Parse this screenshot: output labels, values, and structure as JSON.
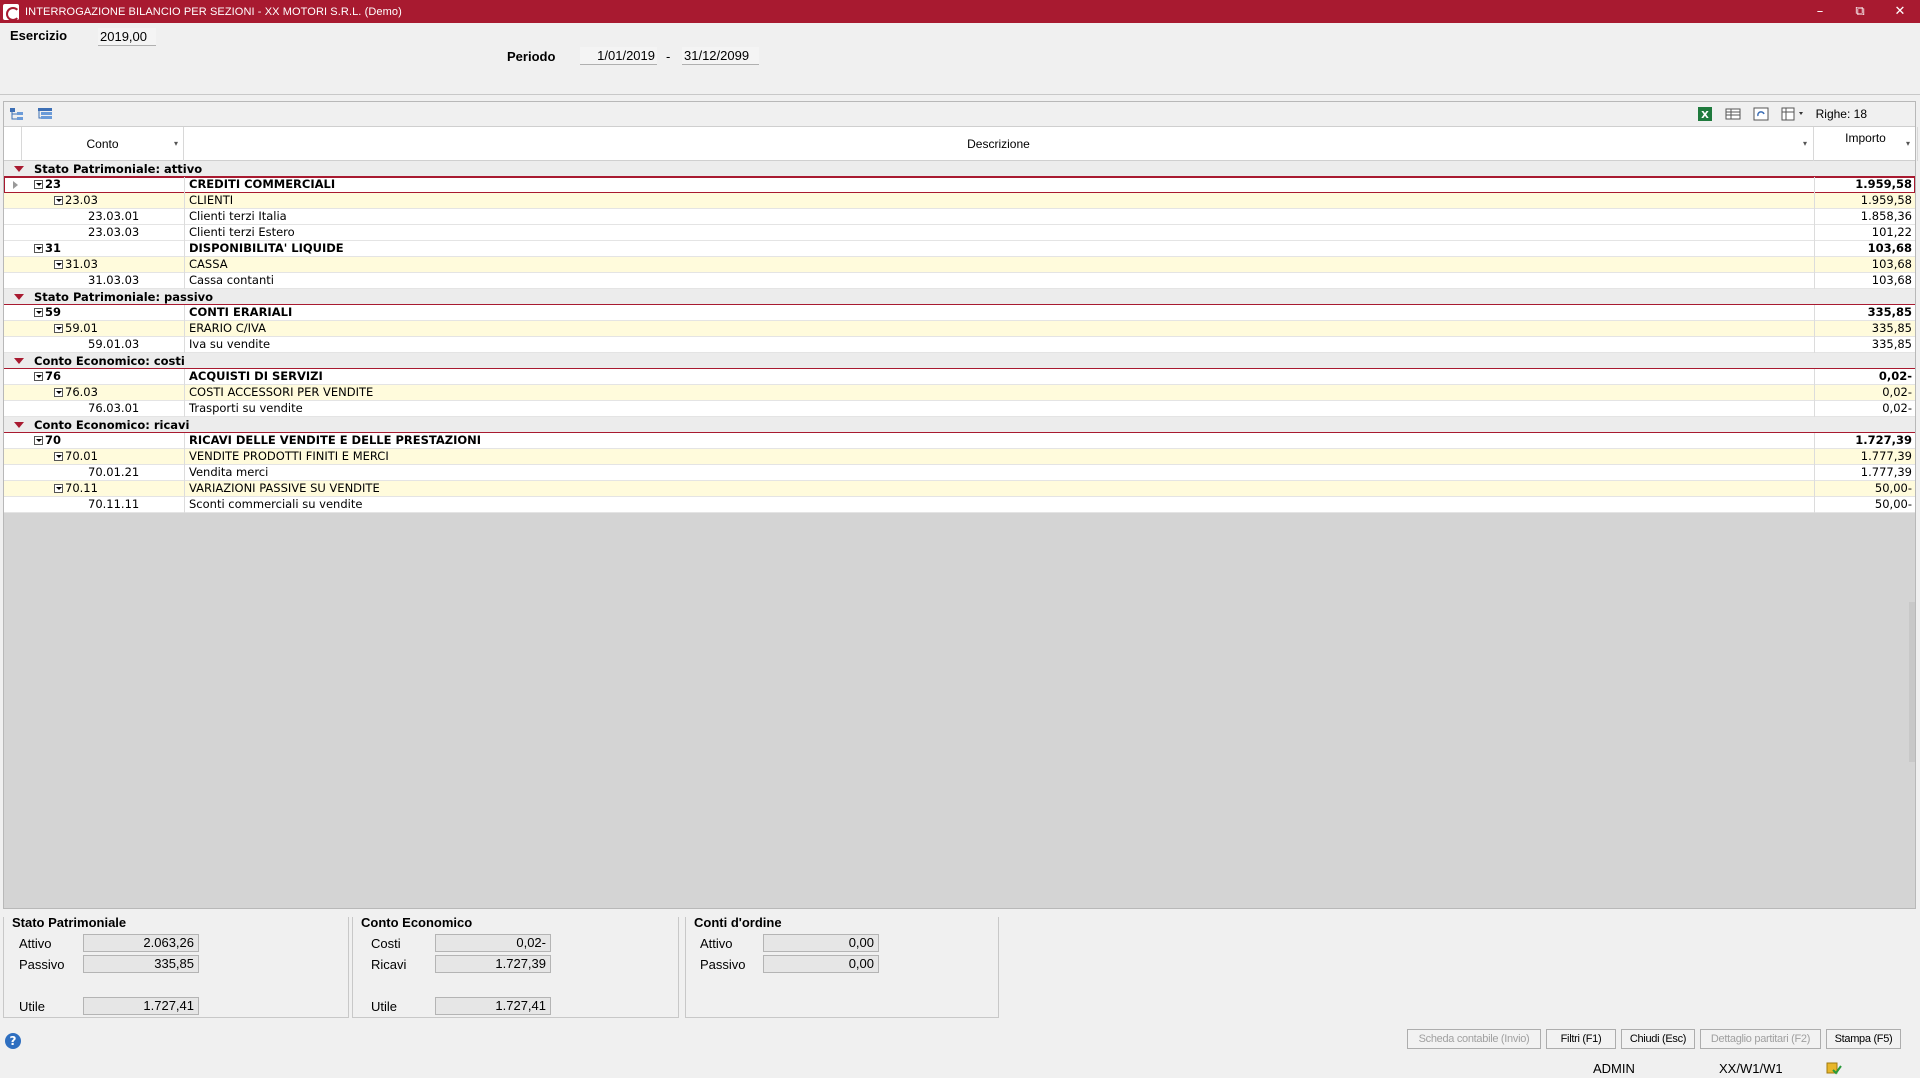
{
  "window": {
    "title": "INTERROGAZIONE BILANCIO PER SEZIONI - XX  MOTORI S.R.L.  (Demo)",
    "controls": [
      "–",
      "⧉",
      "✕"
    ]
  },
  "header": {
    "esercizio_label": "Esercizio",
    "esercizio_value": "2019,00",
    "periodo_label": "Periodo",
    "periodo_from": "1/01/2019",
    "periodo_sep": "-",
    "periodo_to": "31/12/2099"
  },
  "grid": {
    "righe_label": "Righe: 18",
    "columns": {
      "conto": "Conto",
      "descrizione": "Descrizione",
      "importo": "Importo"
    },
    "groups": [
      {
        "title": "Stato Patrimoniale: attivo",
        "rows": [
          {
            "level": 1,
            "conto": "23",
            "descrizione": "CREDITI COMMERCIALI",
            "importo": "1.959,58"
          },
          {
            "level": 2,
            "conto": "23.03",
            "descrizione": "CLIENTI",
            "importo": "1.959,58"
          },
          {
            "level": 3,
            "conto": "23.03.01",
            "descrizione": "Clienti terzi Italia",
            "importo": "1.858,36"
          },
          {
            "level": 3,
            "conto": "23.03.03",
            "descrizione": "Clienti terzi Estero",
            "importo": "101,22"
          },
          {
            "level": 1,
            "conto": "31",
            "descrizione": "DISPONIBILITA' LIQUIDE",
            "importo": "103,68"
          },
          {
            "level": 2,
            "conto": "31.03",
            "descrizione": "CASSA",
            "importo": "103,68"
          },
          {
            "level": 3,
            "conto": "31.03.03",
            "descrizione": "Cassa contanti",
            "importo": "103,68"
          }
        ]
      },
      {
        "title": "Stato Patrimoniale: passivo",
        "rows": [
          {
            "level": 1,
            "conto": "59",
            "descrizione": "CONTI ERARIALI",
            "importo": "335,85"
          },
          {
            "level": 2,
            "conto": "59.01",
            "descrizione": "ERARIO C/IVA",
            "importo": "335,85"
          },
          {
            "level": 3,
            "conto": "59.01.03",
            "descrizione": "Iva su vendite",
            "importo": "335,85"
          }
        ]
      },
      {
        "title": "Conto Economico: costi",
        "rows": [
          {
            "level": 1,
            "conto": "76",
            "descrizione": "ACQUISTI DI SERVIZI",
            "importo": "0,02-"
          },
          {
            "level": 2,
            "conto": "76.03",
            "descrizione": "COSTI ACCESSORI PER VENDITE",
            "importo": "0,02-"
          },
          {
            "level": 3,
            "conto": "76.03.01",
            "descrizione": "Trasporti su vendite",
            "importo": "0,02-"
          }
        ]
      },
      {
        "title": "Conto Economico: ricavi",
        "rows": [
          {
            "level": 1,
            "conto": "70",
            "descrizione": "RICAVI DELLE VENDITE E DELLE PRESTAZIONI",
            "importo": "1.727,39"
          },
          {
            "level": 2,
            "conto": "70.01",
            "descrizione": "VENDITE PRODOTTI FINITI E MERCI",
            "importo": "1.777,39"
          },
          {
            "level": 3,
            "conto": "70.01.21",
            "descrizione": "Vendita merci",
            "importo": "1.777,39"
          },
          {
            "level": 2,
            "conto": "70.11",
            "descrizione": "VARIAZIONI PASSIVE SU VENDITE",
            "importo": "50,00-"
          },
          {
            "level": 3,
            "conto": "70.11.11",
            "descrizione": "Sconti commerciali su vendite",
            "importo": "50,00-"
          }
        ]
      }
    ]
  },
  "summary": {
    "stato_patrimoniale": {
      "title": "Stato Patrimoniale",
      "attivo_label": "Attivo",
      "attivo_value": "2.063,26",
      "passivo_label": "Passivo",
      "passivo_value": "335,85",
      "utile_label": "Utile",
      "utile_value": "1.727,41"
    },
    "conto_economico": {
      "title": "Conto Economico",
      "costi_label": "Costi",
      "costi_value": "0,02-",
      "ricavi_label": "Ricavi",
      "ricavi_value": "1.727,39",
      "utile_label": "Utile",
      "utile_value": "1.727,41"
    },
    "conti_ordine": {
      "title": "Conti d'ordine",
      "attivo_label": "Attivo",
      "attivo_value": "0,00",
      "passivo_label": "Passivo",
      "passivo_value": "0,00"
    }
  },
  "buttons": {
    "scheda": "Scheda contabile (Invio)",
    "filtri": "Filtri (F1)",
    "chiudi": "Chiudi (Esc)",
    "dettaglio": "Dettaglio partitari (F2)",
    "stampa": "Stampa (F5)"
  },
  "status": {
    "user": "ADMIN",
    "path": "XX/W1/W1"
  },
  "colors": {
    "accent": "#a81a30",
    "subtotal_row": "#fffbdc"
  }
}
